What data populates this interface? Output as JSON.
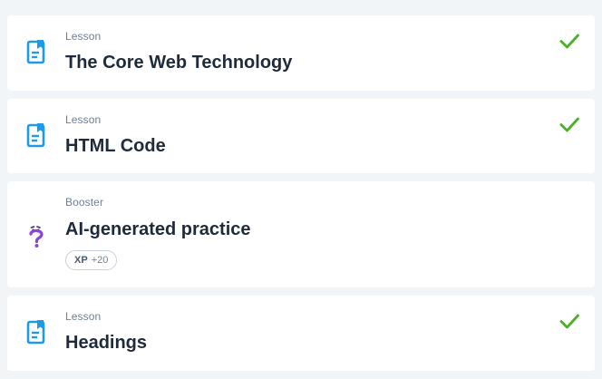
{
  "items": [
    {
      "type": "Lesson",
      "title": "The Core Web Technology",
      "icon": "lesson-document-icon",
      "completed": true
    },
    {
      "type": "Lesson",
      "title": "HTML Code",
      "icon": "lesson-document-icon",
      "completed": true
    },
    {
      "type": "Booster",
      "title": "AI-generated practice",
      "icon": "question-mark-icon",
      "completed": false,
      "xp_label": "XP",
      "xp_value": "+20"
    },
    {
      "type": "Lesson",
      "title": "Headings",
      "icon": "lesson-document-icon",
      "completed": true
    }
  ],
  "colors": {
    "accent_blue": "#1b9be8",
    "check_green": "#4caf2a",
    "booster_purple": "#8b44d6",
    "title_text": "#1f2b3a",
    "label_text": "#6f7f92"
  }
}
